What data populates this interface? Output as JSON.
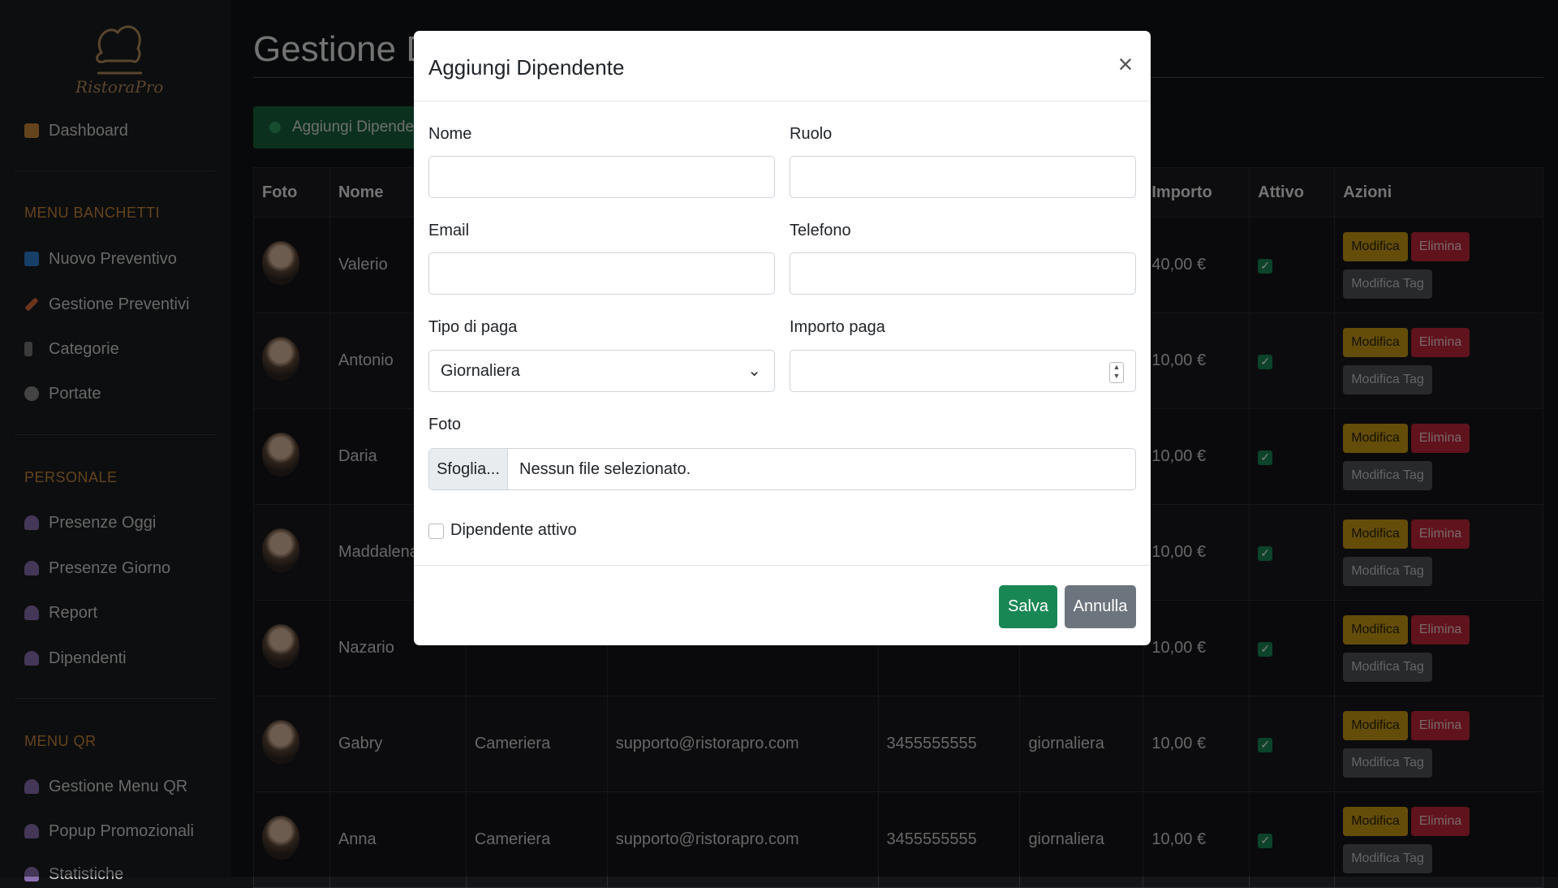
{
  "app": {
    "logo_text": "RistoraPro"
  },
  "sidebar": {
    "top_items": [
      {
        "label": "Dashboard",
        "icon": "home-icon"
      }
    ],
    "sections": [
      {
        "title": "MENU BANCHETTI",
        "items": [
          {
            "label": "Nuovo Preventivo",
            "icon": "new-icon"
          },
          {
            "label": "Gestione Preventivi",
            "icon": "pencil-icon"
          },
          {
            "label": "Categorie",
            "icon": "cutlery-icon"
          },
          {
            "label": "Portate",
            "icon": "plate-icon"
          }
        ]
      },
      {
        "title": "PERSONALE",
        "items": [
          {
            "label": "Presenze Oggi",
            "icon": "person-icon"
          },
          {
            "label": "Presenze Giorno",
            "icon": "person-icon"
          },
          {
            "label": "Report",
            "icon": "person-icon"
          },
          {
            "label": "Dipendenti",
            "icon": "person-icon"
          }
        ]
      },
      {
        "title": "MENU QR",
        "items": [
          {
            "label": "Gestione Menu QR",
            "icon": "person-icon"
          },
          {
            "label": "Popup Promozionali",
            "icon": "person-icon"
          },
          {
            "label": "Statistiche",
            "icon": "person-icon"
          }
        ]
      }
    ]
  },
  "main": {
    "title": "Gestione Dip",
    "add_button": "Aggiungi Dipenden",
    "table": {
      "headers": [
        "Foto",
        "Nome",
        "",
        "",
        "",
        "",
        "Importo",
        "Attivo",
        "Azioni"
      ],
      "rows": [
        {
          "name": "Valerio",
          "role": "",
          "email": "",
          "phone": "",
          "pay_type": "",
          "amount": "40,00 €"
        },
        {
          "name": "Antonio",
          "role": "",
          "email": "",
          "phone": "",
          "pay_type": "",
          "amount": "10,00 €"
        },
        {
          "name": "Daria",
          "role": "",
          "email": "",
          "phone": "",
          "pay_type": "",
          "amount": "10,00 €"
        },
        {
          "name": "Maddalena",
          "role": "",
          "email": "",
          "phone": "",
          "pay_type": "",
          "amount": "10,00 €"
        },
        {
          "name": "Nazario",
          "role": "",
          "email": "",
          "phone": "",
          "pay_type": "",
          "amount": "10,00 €"
        },
        {
          "name": "Gabry",
          "role": "Cameriera",
          "email": "supporto@ristorapro.com",
          "phone": "3455555555",
          "pay_type": "giornaliera",
          "amount": "10,00 €"
        },
        {
          "name": "Anna",
          "role": "Cameriera",
          "email": "supporto@ristorapro.com",
          "phone": "3455555555",
          "pay_type": "giornaliera",
          "amount": "10,00 €"
        }
      ],
      "actions": {
        "edit": "Modifica",
        "delete": "Elimina",
        "edit_tag": "Modifica Tag"
      }
    }
  },
  "modal": {
    "title": "Aggiungi Dipendente",
    "fields": {
      "nome": {
        "label": "Nome",
        "value": ""
      },
      "ruolo": {
        "label": "Ruolo",
        "value": ""
      },
      "email": {
        "label": "Email",
        "value": ""
      },
      "telefono": {
        "label": "Telefono",
        "value": ""
      },
      "tipo_paga": {
        "label": "Tipo di paga",
        "value": "Giornaliera"
      },
      "importo_paga": {
        "label": "Importo paga",
        "value": ""
      },
      "foto": {
        "label": "Foto",
        "button": "Sfoglia...",
        "status": "Nessun file selezionato."
      },
      "attivo": {
        "label": "Dipendente attivo",
        "checked": false
      }
    },
    "save_label": "Salva",
    "cancel_label": "Annulla"
  },
  "colors": {
    "accent_green": "#198754",
    "warning": "#c89a10",
    "danger": "#c0273a",
    "section_title": "#c8893a"
  }
}
